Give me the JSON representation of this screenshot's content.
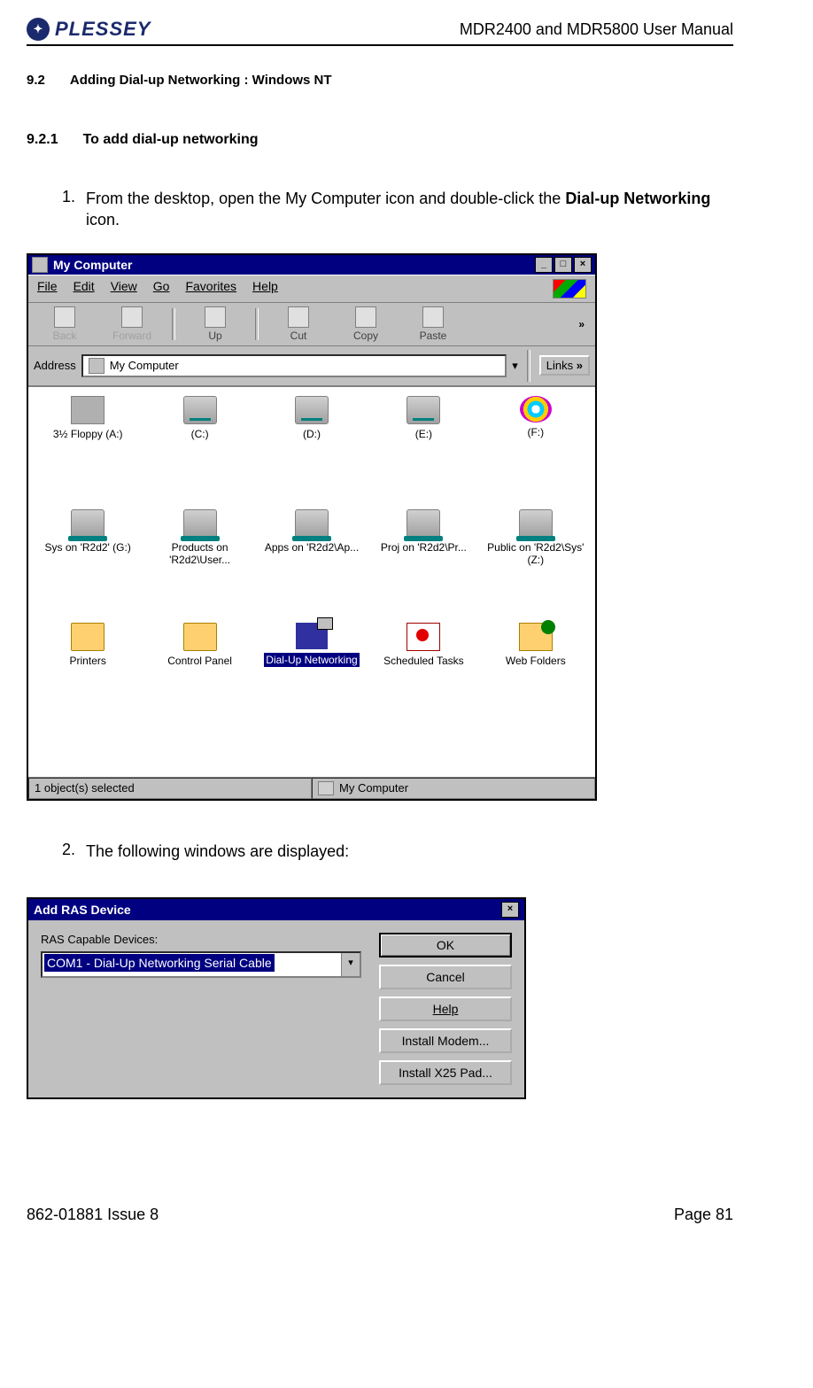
{
  "header": {
    "logo_text": "PLESSEY",
    "logo_badge": "✦",
    "doc_title": "MDR2400 and MDR5800 User Manual"
  },
  "section": {
    "num": "9.2",
    "title": "Adding Dial-up Networking : Windows NT"
  },
  "subsection": {
    "num": "9.2.1",
    "title": "To add dial-up networking"
  },
  "steps": [
    {
      "num": "1.",
      "text_a": "From the desktop, open the My Computer icon and double-click the ",
      "bold": "Dial-up Networking",
      "text_b": " icon."
    },
    {
      "num": "2.",
      "text_a": "The following windows are displayed:",
      "bold": "",
      "text_b": ""
    }
  ],
  "mycomputer": {
    "title": "My Computer",
    "menus": [
      "File",
      "Edit",
      "View",
      "Go",
      "Favorites",
      "Help"
    ],
    "toolbar": {
      "back": "Back",
      "forward": "Forward",
      "up": "Up",
      "cut": "Cut",
      "copy": "Copy",
      "paste": "Paste",
      "more": "»"
    },
    "address_label": "Address",
    "address_value": "My Computer",
    "links_label": "Links",
    "links_more": "»",
    "items": [
      {
        "label": "3½ Floppy (A:)"
      },
      {
        "label": "(C:)"
      },
      {
        "label": "(D:)"
      },
      {
        "label": "(E:)"
      },
      {
        "label": "(F:)"
      },
      {
        "label": "Sys on 'R2d2' (G:)"
      },
      {
        "label": "Products on 'R2d2\\User..."
      },
      {
        "label": "Apps on 'R2d2\\Ap..."
      },
      {
        "label": "Proj on 'R2d2\\Pr..."
      },
      {
        "label": "Public on 'R2d2\\Sys' (Z:)"
      },
      {
        "label": "Printers"
      },
      {
        "label": "Control Panel"
      },
      {
        "label": "Dial-Up Networking"
      },
      {
        "label": "Scheduled Tasks"
      },
      {
        "label": "Web Folders"
      }
    ],
    "status_left": "1 object(s) selected",
    "status_right": "My Computer"
  },
  "dialog": {
    "title": "Add RAS Device",
    "label": "RAS Capable Devices:",
    "combo_value": "COM1 - Dial-Up Networking Serial Cable",
    "buttons": {
      "ok": "OK",
      "cancel": "Cancel",
      "help": "Help",
      "install_modem": "Install Modem...",
      "install_x25": "Install X25 Pad..."
    }
  },
  "footer": {
    "left": "862-01881 Issue 8",
    "right": "Page 81"
  }
}
